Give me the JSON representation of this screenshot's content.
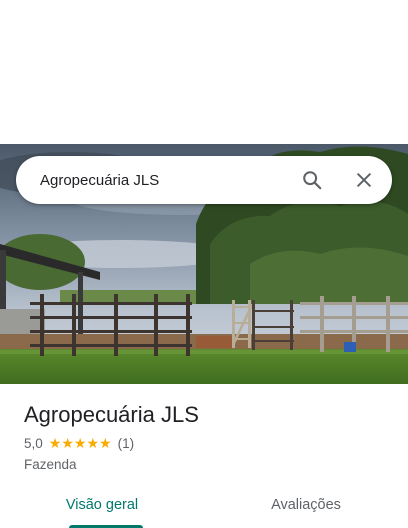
{
  "search": {
    "query": "Agropecuária JLS",
    "search_icon": "search-icon",
    "close_icon": "close-icon"
  },
  "place": {
    "name": "Agropecuária JLS",
    "rating": "5,0",
    "stars_filled": 5,
    "review_count": "(1)",
    "category": "Fazenda",
    "photo": "farm-corral-photo"
  },
  "tabs": [
    {
      "label": "Visão geral",
      "active": true
    },
    {
      "label": "Avaliações",
      "active": false
    }
  ],
  "colors": {
    "accent": "#00796b",
    "star": "#f9ab00",
    "text_primary": "#202124",
    "text_secondary": "#5f6368"
  }
}
